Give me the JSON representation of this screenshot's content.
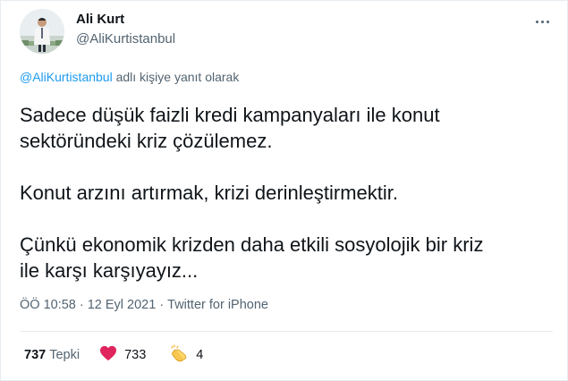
{
  "author": {
    "name": "Ali Kurt",
    "handle": "@AliKurtistanbul"
  },
  "reply_context": {
    "mention": "@AliKurtistanbul",
    "suffix": " adlı kişiye yanıt olarak"
  },
  "tweet": {
    "line1": "Sadece düşük faizli kredi kampanyaları ile konut",
    "line2": "sektöründeki kriz çözülemez.",
    "line3": "Konut arzını artırmak, krizi derinleştirmektir.",
    "line4": "Çünkü ekonomik krizden daha etkili sosyolojik bir kriz",
    "line5": "ile karşı karşıyayız..."
  },
  "meta": {
    "time": "ÖÖ 10:58",
    "dot1": "·",
    "date": "12 Eyl 2021",
    "dot2": "·",
    "source": "Twitter for iPhone"
  },
  "stats": {
    "quotes_count": "737",
    "quotes_label": "Tepki",
    "likes_count": "733",
    "claps_count": "4"
  },
  "icons": {
    "more": "more-dots-icon",
    "like": "heart-icon",
    "clap": "clapping-hands-icon"
  },
  "colors": {
    "link": "#1d9bf0",
    "secondary_text": "#536471",
    "primary_text": "#0f1419",
    "heart": "#e0245e"
  }
}
